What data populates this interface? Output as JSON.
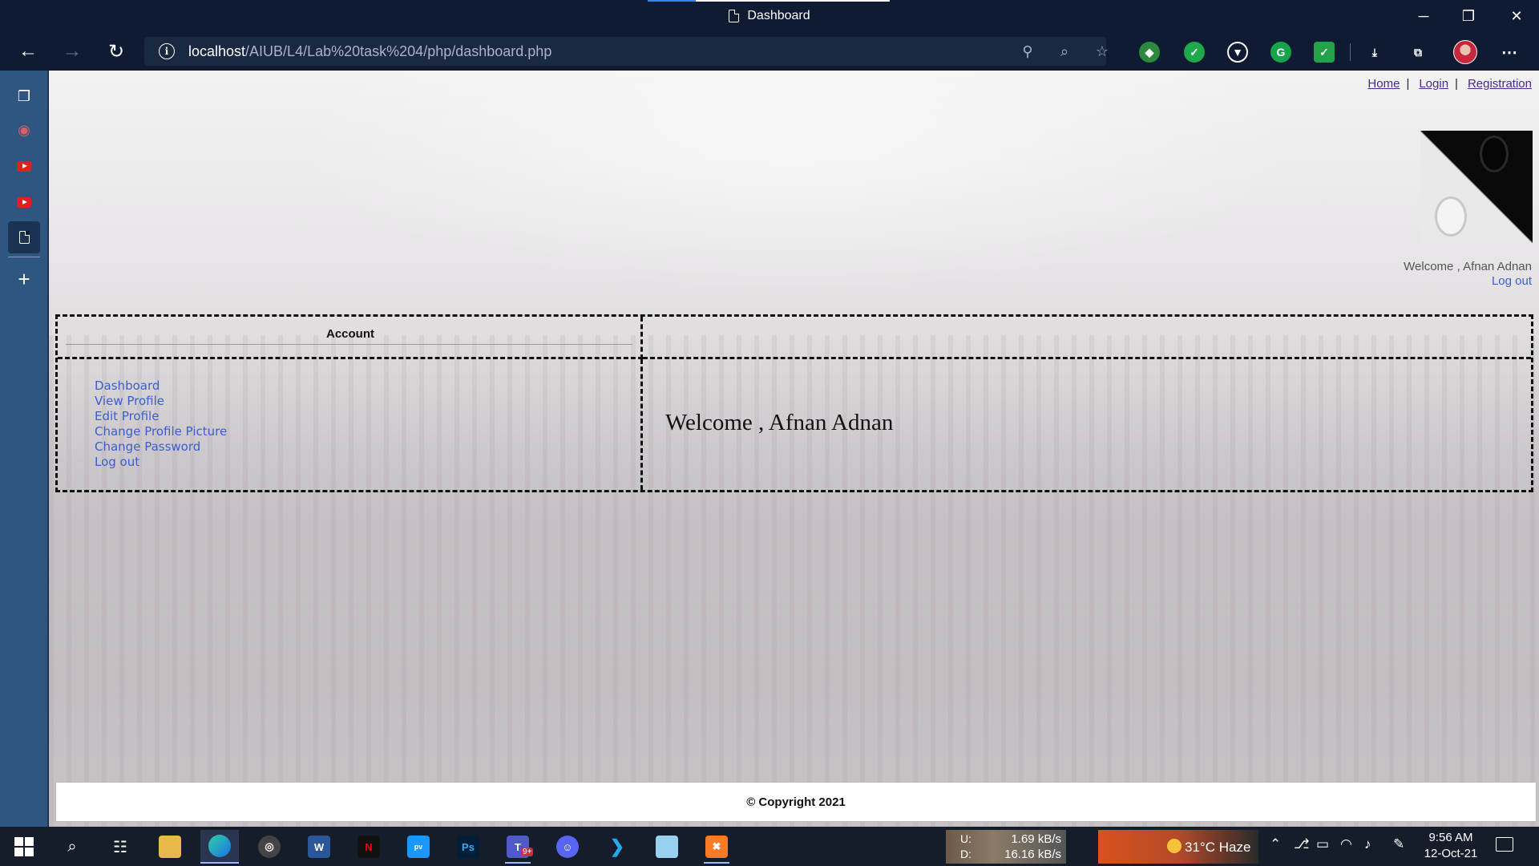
{
  "browser": {
    "tab_title": "Dashboard",
    "url_host": "localhost",
    "url_path": "/AIUB/L4/Lab%20task%204/php/dashboard.php"
  },
  "page": {
    "top_links": [
      "Home",
      "Login",
      "Registration"
    ],
    "top_link_separator": "|",
    "welcome_small": "Welcome , Afnan Adnan",
    "logout_small": "Log out",
    "account_heading": "Account",
    "menu": [
      "Dashboard",
      "View Profile",
      "Edit Profile",
      "Change Profile Picture",
      "Change Password",
      "Log out"
    ],
    "welcome_big": "Welcome , Afnan Adnan",
    "footer": "© Copyright 2021"
  },
  "taskbar": {
    "upload_label": "U:",
    "download_label": "D:",
    "upload_speed": "1.69 kB/s",
    "download_speed": "16.16 kB/s",
    "weather": "31°C  Haze",
    "time": "9:56 AM",
    "date": "12-Oct-21",
    "teams_badge": "9+"
  },
  "colors": {
    "chrome": "#0e1b33",
    "sidebar": "#2f5680",
    "link": "#3a5fcd",
    "visited_link": "#4a2a8a"
  }
}
